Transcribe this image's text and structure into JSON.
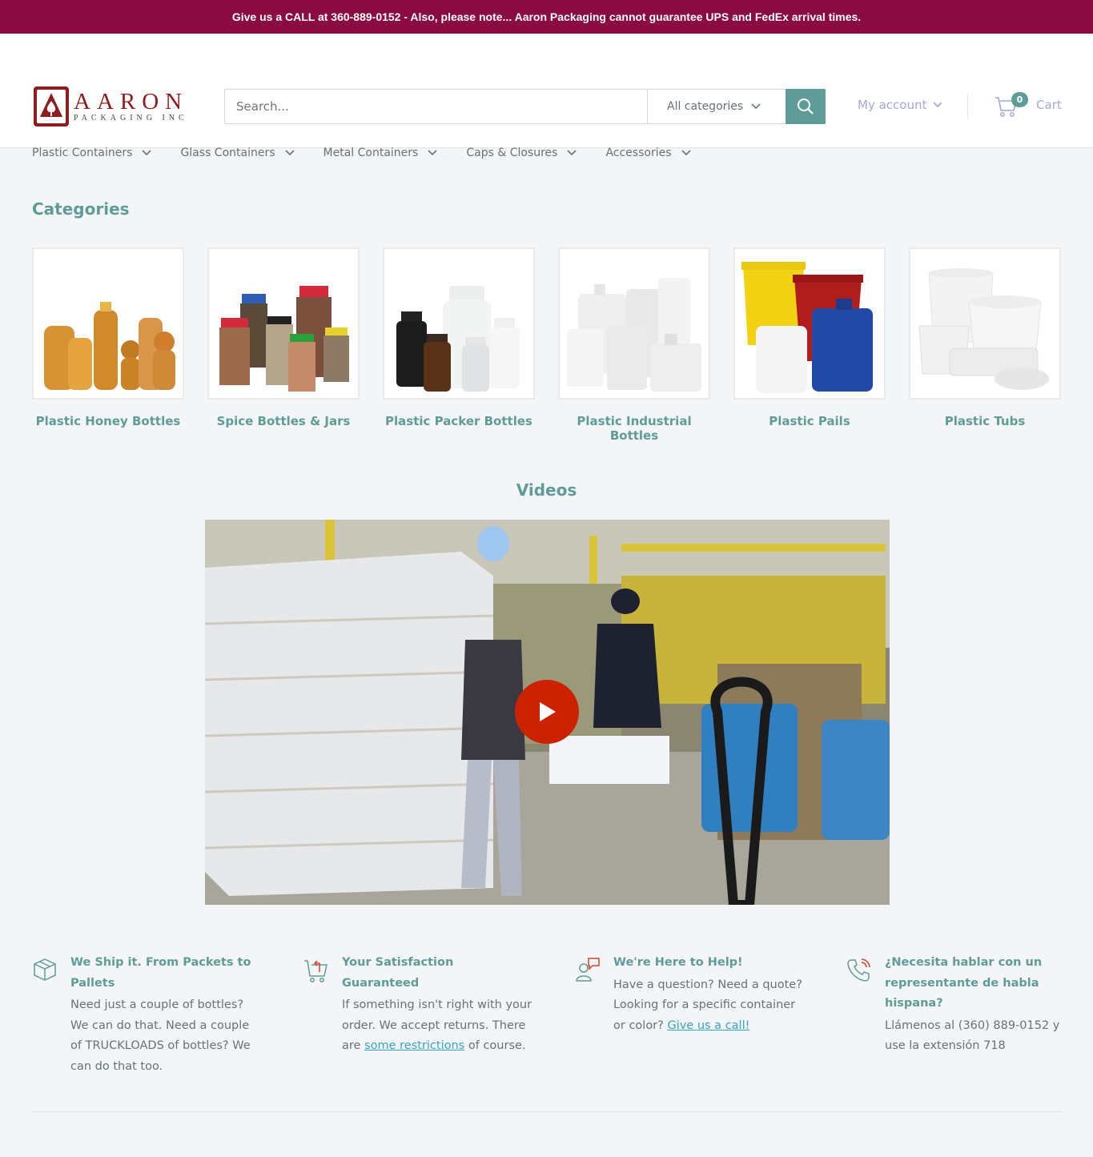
{
  "announcement": "Give us a CALL at 360-889-0152 - Also, please note... Aaron Packaging cannot guarantee UPS and FedEx arrival times.",
  "logo": {
    "name": "AARON",
    "sub": "PACKAGING INC"
  },
  "search": {
    "placeholder": "Search...",
    "category": "All categories"
  },
  "account": {
    "label": "My account"
  },
  "cart": {
    "label": "Cart",
    "count": "0"
  },
  "nav": [
    "Plastic Containers",
    "Glass Containers",
    "Metal Containers",
    "Caps & Closures",
    "Accessories"
  ],
  "categories": {
    "title": "Categories",
    "items": [
      {
        "label": "Plastic Honey Bottles"
      },
      {
        "label": "Spice Bottles & Jars"
      },
      {
        "label": "Plastic Packer Bottles"
      },
      {
        "label": "Plastic Industrial Bottles"
      },
      {
        "label": "Plastic Pails"
      },
      {
        "label": "Plastic Tubs"
      }
    ]
  },
  "videos": {
    "title": "Videos"
  },
  "features": [
    {
      "title": "We Ship it. From Packets to Pallets",
      "text": "Need just a couple of bottles? We can do that. Need a couple of TRUCKLOADS of bottles? We can do that too."
    },
    {
      "title": "Your Satisfaction Guaranteed",
      "text_before": "If something isn't right with your order. We accept returns. There are ",
      "link": "some restrictions",
      "text_after": " of course."
    },
    {
      "title": "We're Here to Help!",
      "text_before": "Have a question? Need a quote? Looking for a specific container or color? ",
      "link": "Give us a call!"
    },
    {
      "title": "¿Necesita hablar con un representante de habla hispana?",
      "text": "Llámenos al (360) 889-0152 y use la extensión 718"
    }
  ],
  "colors": {
    "announcement_bg": "#8a0b41",
    "accent": "#5f9c98",
    "link": "#37a3c6",
    "account": "#a0a9d8",
    "play_button": "#cc2200"
  }
}
